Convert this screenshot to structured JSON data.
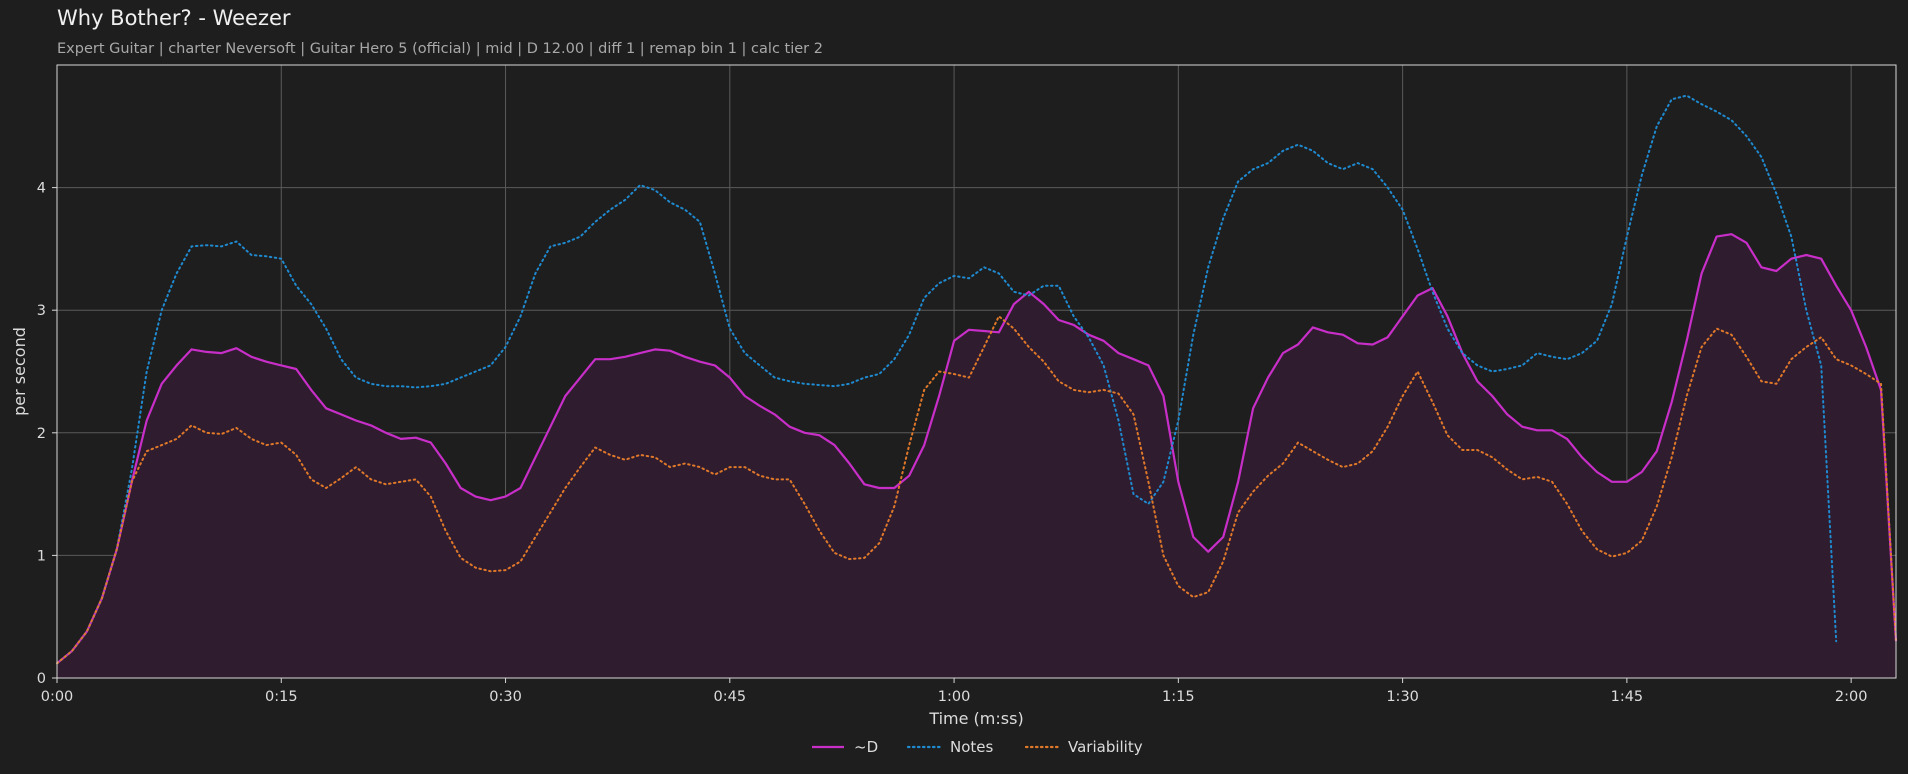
{
  "header": {
    "title": "Why Bother? - Weezer",
    "subtitle": "Expert Guitar  |  charter Neversoft  |  Guitar Hero 5 (official)  |  mid  |  D 12.00  |  diff 1  |  remap bin 1  |  calc tier 2"
  },
  "colors": {
    "background": "#1e1e1e",
    "plot_border": "#d8d8d8",
    "grid": "#5a5a5a",
    "d_line": "#c82ec8",
    "d_fill": "#2f1c2f",
    "notes_line": "#1f8ad0",
    "variability_line": "#e0782a"
  },
  "chart_data": {
    "type": "line",
    "title": "Why Bother? - Weezer",
    "xlabel": "Time (m:ss)",
    "ylabel": "per second",
    "xlim": [
      0,
      123
    ],
    "ylim": [
      0,
      5
    ],
    "grid": true,
    "legend_position": "bottom-center",
    "xticks": [
      0,
      15,
      30,
      45,
      60,
      75,
      90,
      105,
      120
    ],
    "xtick_labels": [
      "0:00",
      "0:15",
      "0:30",
      "0:45",
      "1:00",
      "1:15",
      "1:30",
      "1:45",
      "2:00"
    ],
    "yticks": [
      0,
      1,
      2,
      3,
      4
    ],
    "ytick_labels": [
      "0",
      "1",
      "2",
      "3",
      "4"
    ],
    "x": [
      0,
      1,
      2,
      3,
      4,
      5,
      6,
      7,
      8,
      9,
      10,
      11,
      12,
      13,
      14,
      15,
      16,
      17,
      18,
      19,
      20,
      21,
      22,
      23,
      24,
      25,
      26,
      27,
      28,
      29,
      30,
      31,
      32,
      33,
      34,
      35,
      36,
      37,
      38,
      39,
      40,
      41,
      42,
      43,
      44,
      45,
      46,
      47,
      48,
      49,
      50,
      51,
      52,
      53,
      54,
      55,
      56,
      57,
      58,
      59,
      60,
      61,
      62,
      63,
      64,
      65,
      66,
      67,
      68,
      69,
      70,
      71,
      72,
      73,
      74,
      75,
      76,
      77,
      78,
      79,
      80,
      81,
      82,
      83,
      84,
      85,
      86,
      87,
      88,
      89,
      90,
      91,
      92,
      93,
      94,
      95,
      96,
      97,
      98,
      99,
      100,
      101,
      102,
      103,
      104,
      105,
      106,
      107,
      108,
      109,
      110,
      111,
      112,
      113,
      114,
      115,
      116,
      117,
      118,
      119,
      120,
      121,
      122,
      123
    ],
    "series": [
      {
        "name": "~D",
        "style": "solid",
        "filled": true,
        "values": [
          0.12,
          0.22,
          0.38,
          0.65,
          1.05,
          1.6,
          2.1,
          2.4,
          2.55,
          2.68,
          2.66,
          2.65,
          2.69,
          2.62,
          2.58,
          2.55,
          2.52,
          2.35,
          2.2,
          2.15,
          2.1,
          2.06,
          2.0,
          1.95,
          1.96,
          1.92,
          1.75,
          1.55,
          1.48,
          1.45,
          1.48,
          1.55,
          1.8,
          2.05,
          2.3,
          2.45,
          2.6,
          2.6,
          2.62,
          2.65,
          2.68,
          2.67,
          2.62,
          2.58,
          2.55,
          2.45,
          2.3,
          2.22,
          2.15,
          2.05,
          2.0,
          1.98,
          1.9,
          1.75,
          1.58,
          1.55,
          1.55,
          1.65,
          1.9,
          2.3,
          2.75,
          2.84,
          2.83,
          2.82,
          3.05,
          3.15,
          3.05,
          2.92,
          2.88,
          2.8,
          2.75,
          2.65,
          2.6,
          2.55,
          2.3,
          1.6,
          1.15,
          1.03,
          1.15,
          1.6,
          2.2,
          2.45,
          2.65,
          2.72,
          2.86,
          2.82,
          2.8,
          2.73,
          2.72,
          2.78,
          2.95,
          3.12,
          3.18,
          2.95,
          2.65,
          2.42,
          2.3,
          2.15,
          2.05,
          2.02,
          2.02,
          1.95,
          1.8,
          1.68,
          1.6,
          1.6,
          1.68,
          1.85,
          2.25,
          2.75,
          3.3,
          3.6,
          3.62,
          3.55,
          3.35,
          3.32,
          3.42,
          3.45,
          3.42,
          3.2,
          3.0,
          2.7,
          2.35,
          0.3
        ]
      },
      {
        "name": "Notes",
        "style": "dotted",
        "filled": false,
        "values": [
          0.12,
          0.22,
          0.38,
          0.65,
          1.05,
          1.7,
          2.5,
          3.0,
          3.3,
          3.52,
          3.53,
          3.52,
          3.56,
          3.45,
          3.44,
          3.42,
          3.2,
          3.05,
          2.85,
          2.6,
          2.45,
          2.4,
          2.38,
          2.38,
          2.37,
          2.38,
          2.4,
          2.45,
          2.5,
          2.55,
          2.7,
          2.95,
          3.3,
          3.52,
          3.55,
          3.6,
          3.72,
          3.82,
          3.9,
          4.02,
          3.98,
          3.88,
          3.82,
          3.72,
          3.3,
          2.85,
          2.65,
          2.55,
          2.45,
          2.42,
          2.4,
          2.39,
          2.38,
          2.4,
          2.45,
          2.48,
          2.6,
          2.8,
          3.1,
          3.22,
          3.28,
          3.26,
          3.35,
          3.3,
          3.15,
          3.12,
          3.2,
          3.2,
          2.95,
          2.78,
          2.55,
          2.1,
          1.5,
          1.42,
          1.6,
          2.1,
          2.8,
          3.35,
          3.75,
          4.05,
          4.15,
          4.2,
          4.3,
          4.35,
          4.3,
          4.2,
          4.15,
          4.2,
          4.15,
          4.0,
          3.82,
          3.5,
          3.15,
          2.85,
          2.65,
          2.55,
          2.5,
          2.52,
          2.55,
          2.65,
          2.62,
          2.6,
          2.65,
          2.75,
          3.05,
          3.6,
          4.1,
          4.5,
          4.72,
          4.75,
          4.68,
          4.62,
          4.55,
          4.42,
          4.25,
          3.95,
          3.6,
          3.0,
          2.55,
          0.3
        ]
      },
      {
        "name": "Variability",
        "style": "dotted",
        "filled": false,
        "values": [
          0.12,
          0.22,
          0.38,
          0.65,
          1.05,
          1.6,
          1.85,
          1.9,
          1.95,
          2.06,
          2.0,
          1.99,
          2.04,
          1.95,
          1.9,
          1.92,
          1.82,
          1.62,
          1.55,
          1.63,
          1.72,
          1.62,
          1.58,
          1.6,
          1.62,
          1.48,
          1.2,
          0.98,
          0.9,
          0.87,
          0.88,
          0.95,
          1.15,
          1.35,
          1.55,
          1.72,
          1.88,
          1.82,
          1.78,
          1.82,
          1.8,
          1.72,
          1.75,
          1.72,
          1.66,
          1.72,
          1.72,
          1.65,
          1.62,
          1.62,
          1.42,
          1.2,
          1.02,
          0.97,
          0.98,
          1.1,
          1.4,
          1.9,
          2.35,
          2.5,
          2.48,
          2.45,
          2.7,
          2.95,
          2.85,
          2.7,
          2.58,
          2.42,
          2.35,
          2.33,
          2.35,
          2.32,
          2.15,
          1.6,
          1.0,
          0.75,
          0.66,
          0.7,
          0.95,
          1.35,
          1.52,
          1.65,
          1.75,
          1.92,
          1.85,
          1.78,
          1.72,
          1.75,
          1.85,
          2.05,
          2.3,
          2.5,
          2.25,
          1.98,
          1.86,
          1.86,
          1.8,
          1.7,
          1.62,
          1.64,
          1.6,
          1.42,
          1.2,
          1.05,
          0.99,
          1.02,
          1.12,
          1.4,
          1.8,
          2.3,
          2.7,
          2.85,
          2.8,
          2.62,
          2.42,
          2.4,
          2.6,
          2.7,
          2.78,
          2.6,
          2.55,
          2.48,
          2.4,
          0.3
        ]
      }
    ]
  }
}
